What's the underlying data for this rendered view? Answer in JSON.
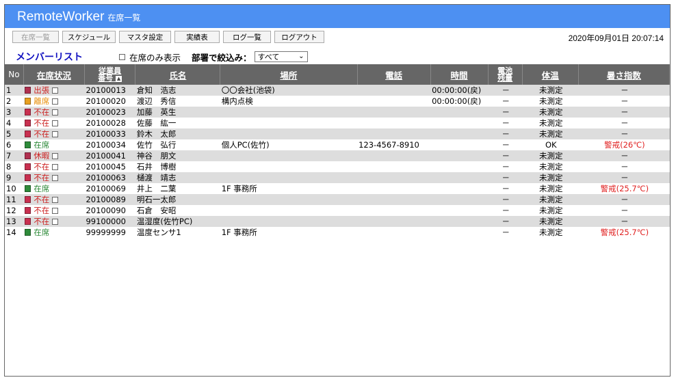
{
  "app": {
    "name": "RemoteWorker",
    "subtitle": "在席一覧"
  },
  "toolbar": {
    "buttons": [
      "在席一覧",
      "スケジュール",
      "マスタ設定",
      "実績表",
      "ログ一覧",
      "ログアウト"
    ],
    "datetime": "2020年09月01日 20:07:14"
  },
  "list": {
    "title": "メンバーリスト",
    "present_only_label": "在席のみ表示",
    "dept_label": "部署で絞込み：",
    "dept_value": "すべて"
  },
  "columns": [
    "No",
    "在席状況",
    "従業員",
    "番号",
    "氏名",
    "場所",
    "電話",
    "時間",
    "電池",
    "残量",
    "体温",
    "暑さ指数"
  ],
  "colors": {
    "present": "#2e8b3a",
    "away": "#e8900c",
    "absent": "#d03030",
    "status_red": "#cc2020",
    "alert": "#e02020",
    "header": "#666666",
    "title_bar": "#4d90f2"
  },
  "rows": [
    {
      "no": "1",
      "status": "出張",
      "status_type": "absent",
      "color": "#b03050",
      "emp": "20100013",
      "name": "倉知　浩志",
      "place": "〇〇会社(池袋)",
      "phone": "",
      "time": "00:00:00(戻)",
      "battery": "－",
      "temp": "未測定",
      "heat": "－"
    },
    {
      "no": "2",
      "status": "離席",
      "status_type": "away",
      "color": "#e8a020",
      "emp": "20100020",
      "name": "渡辺　秀信",
      "place": "構内点検",
      "phone": "",
      "time": "00:00:00(戻)",
      "battery": "－",
      "temp": "未測定",
      "heat": "－"
    },
    {
      "no": "3",
      "status": "不在",
      "status_type": "absent",
      "color": "#c83050",
      "emp": "20100023",
      "name": "加藤　英生",
      "place": "",
      "phone": "",
      "time": "",
      "battery": "－",
      "temp": "未測定",
      "heat": "－"
    },
    {
      "no": "4",
      "status": "不在",
      "status_type": "absent",
      "color": "#c83050",
      "emp": "20100028",
      "name": "佐藤　紘一",
      "place": "",
      "phone": "",
      "time": "",
      "battery": "－",
      "temp": "未測定",
      "heat": "－"
    },
    {
      "no": "5",
      "status": "不在",
      "status_type": "absent",
      "color": "#c83050",
      "emp": "20100033",
      "name": "鈴木　太郎",
      "place": "",
      "phone": "",
      "time": "",
      "battery": "－",
      "temp": "未測定",
      "heat": "－"
    },
    {
      "no": "6",
      "status": "在席",
      "status_type": "present",
      "color": "#2e8b3a",
      "emp": "20100034",
      "name": "佐竹　弘行",
      "place": "個人PC(佐竹)",
      "phone": "123-4567-8910",
      "time": "",
      "battery": "－",
      "temp": "OK",
      "heat": "警戒(26℃)"
    },
    {
      "no": "7",
      "status": "休暇",
      "status_type": "absent",
      "color": "#b03050",
      "emp": "20100041",
      "name": "神谷　朋文",
      "place": "",
      "phone": "",
      "time": "",
      "battery": "－",
      "temp": "未測定",
      "heat": "－"
    },
    {
      "no": "8",
      "status": "不在",
      "status_type": "absent",
      "color": "#c83050",
      "emp": "20100045",
      "name": "石井　博樹",
      "place": "",
      "phone": "",
      "time": "",
      "battery": "－",
      "temp": "未測定",
      "heat": "－"
    },
    {
      "no": "9",
      "status": "不在",
      "status_type": "absent",
      "color": "#c83050",
      "emp": "20100063",
      "name": "樋渡　靖志",
      "place": "",
      "phone": "",
      "time": "",
      "battery": "－",
      "temp": "未測定",
      "heat": "－"
    },
    {
      "no": "10",
      "status": "在席",
      "status_type": "present",
      "color": "#2e8b3a",
      "emp": "20100069",
      "name": "井上　二葉",
      "place": "1F 事務所",
      "phone": "",
      "time": "",
      "battery": "－",
      "temp": "未測定",
      "heat": "警戒(25.7℃)"
    },
    {
      "no": "11",
      "status": "不在",
      "status_type": "absent",
      "color": "#c83050",
      "emp": "20100089",
      "name": "明石一太郎",
      "place": "",
      "phone": "",
      "time": "",
      "battery": "－",
      "temp": "未測定",
      "heat": "－"
    },
    {
      "no": "12",
      "status": "不在",
      "status_type": "absent",
      "color": "#c83050",
      "emp": "20100090",
      "name": "石倉　安昭",
      "place": "",
      "phone": "",
      "time": "",
      "battery": "－",
      "temp": "未測定",
      "heat": "－"
    },
    {
      "no": "13",
      "status": "不在",
      "status_type": "absent",
      "color": "#c83050",
      "emp": "99100000",
      "name": "温湿度(佐竹PC)",
      "place": "",
      "phone": "",
      "time": "",
      "battery": "－",
      "temp": "未測定",
      "heat": "－"
    },
    {
      "no": "14",
      "status": "在席",
      "status_type": "present",
      "color": "#2e8b3a",
      "emp": "99999999",
      "name": "温度センサ1",
      "place": "1F 事務所",
      "phone": "",
      "time": "",
      "battery": "－",
      "temp": "未測定",
      "heat": "警戒(25.7℃)"
    }
  ]
}
